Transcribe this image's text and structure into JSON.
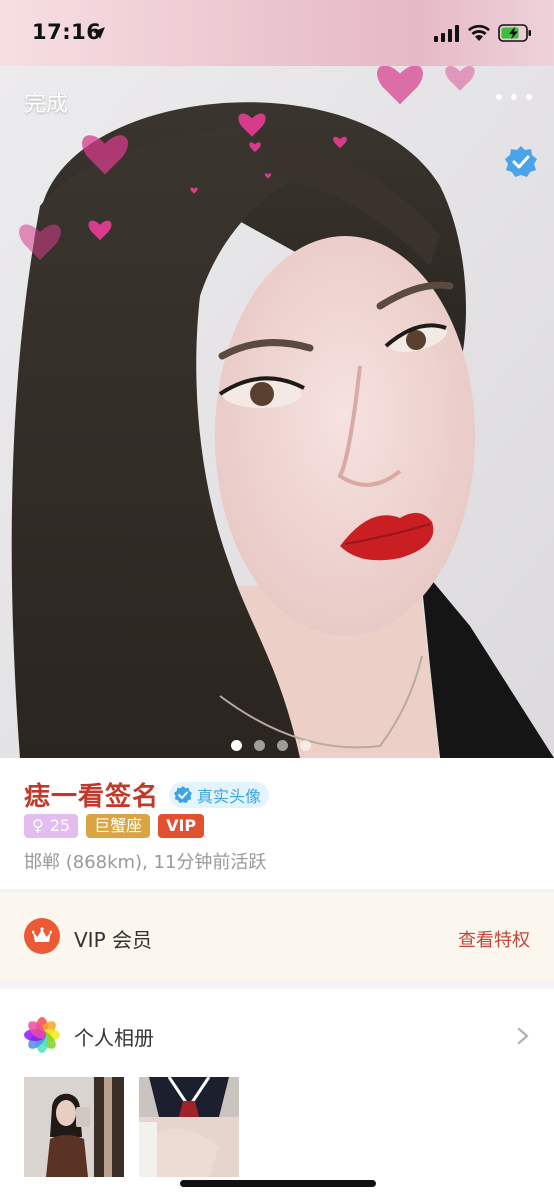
{
  "status_bar": {
    "time": "17:16",
    "icons": [
      "location-arrow-icon",
      "cellular-signal-icon",
      "wifi-icon",
      "battery-charging-icon"
    ]
  },
  "top_bar": {
    "done_label": "完成",
    "more_icon": "more-horizontal-icon"
  },
  "hero": {
    "verified_icon": "verified-check-icon",
    "photo_count": 4,
    "active_photo_index": 0
  },
  "profile": {
    "name": "痣一看签名",
    "real_avatar_badge": "真实头像",
    "gender_symbol": "♀",
    "age": "25",
    "zodiac": "巨蟹座",
    "vip_tag": "VIP",
    "location_activity": "邯郸 (868km), 11分钟前活跃"
  },
  "vip_member": {
    "icon": "crown-icon",
    "label": "VIP 会员",
    "link": "查看特权"
  },
  "album": {
    "icon": "color-wheel-icon",
    "label": "个人相册",
    "chevron_icon": "chevron-right-icon",
    "photos": [
      "album-photo-1",
      "album-photo-2"
    ]
  },
  "colors": {
    "name": "#c0392b",
    "vip_orange": "#ec5a35",
    "badge_blue": "#3aa5e4"
  }
}
